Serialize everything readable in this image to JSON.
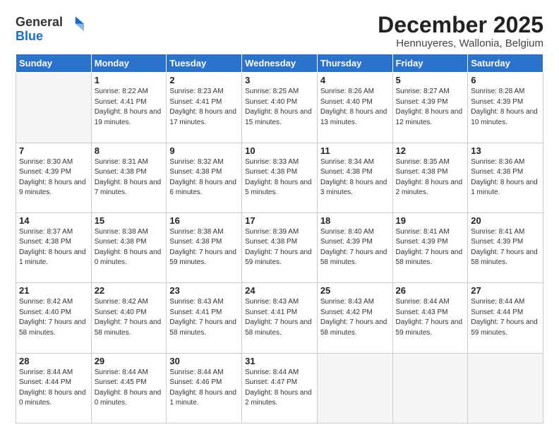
{
  "header": {
    "logo_line1": "General",
    "logo_line2": "Blue",
    "month": "December 2025",
    "location": "Hennuyeres, Wallonia, Belgium"
  },
  "weekdays": [
    "Sunday",
    "Monday",
    "Tuesday",
    "Wednesday",
    "Thursday",
    "Friday",
    "Saturday"
  ],
  "weeks": [
    [
      {
        "day": "",
        "sunrise": "",
        "sunset": "",
        "daylight": ""
      },
      {
        "day": "1",
        "sunrise": "8:22 AM",
        "sunset": "4:41 PM",
        "daylight": "8 hours and 19 minutes."
      },
      {
        "day": "2",
        "sunrise": "8:23 AM",
        "sunset": "4:41 PM",
        "daylight": "8 hours and 17 minutes."
      },
      {
        "day": "3",
        "sunrise": "8:25 AM",
        "sunset": "4:40 PM",
        "daylight": "8 hours and 15 minutes."
      },
      {
        "day": "4",
        "sunrise": "8:26 AM",
        "sunset": "4:40 PM",
        "daylight": "8 hours and 13 minutes."
      },
      {
        "day": "5",
        "sunrise": "8:27 AM",
        "sunset": "4:39 PM",
        "daylight": "8 hours and 12 minutes."
      },
      {
        "day": "6",
        "sunrise": "8:28 AM",
        "sunset": "4:39 PM",
        "daylight": "8 hours and 10 minutes."
      }
    ],
    [
      {
        "day": "7",
        "sunrise": "8:30 AM",
        "sunset": "4:39 PM",
        "daylight": "8 hours and 9 minutes."
      },
      {
        "day": "8",
        "sunrise": "8:31 AM",
        "sunset": "4:38 PM",
        "daylight": "8 hours and 7 minutes."
      },
      {
        "day": "9",
        "sunrise": "8:32 AM",
        "sunset": "4:38 PM",
        "daylight": "8 hours and 6 minutes."
      },
      {
        "day": "10",
        "sunrise": "8:33 AM",
        "sunset": "4:38 PM",
        "daylight": "8 hours and 5 minutes."
      },
      {
        "day": "11",
        "sunrise": "8:34 AM",
        "sunset": "4:38 PM",
        "daylight": "8 hours and 3 minutes."
      },
      {
        "day": "12",
        "sunrise": "8:35 AM",
        "sunset": "4:38 PM",
        "daylight": "8 hours and 2 minutes."
      },
      {
        "day": "13",
        "sunrise": "8:36 AM",
        "sunset": "4:38 PM",
        "daylight": "8 hours and 1 minute."
      }
    ],
    [
      {
        "day": "14",
        "sunrise": "8:37 AM",
        "sunset": "4:38 PM",
        "daylight": "8 hours and 1 minute."
      },
      {
        "day": "15",
        "sunrise": "8:38 AM",
        "sunset": "4:38 PM",
        "daylight": "8 hours and 0 minutes."
      },
      {
        "day": "16",
        "sunrise": "8:38 AM",
        "sunset": "4:38 PM",
        "daylight": "7 hours and 59 minutes."
      },
      {
        "day": "17",
        "sunrise": "8:39 AM",
        "sunset": "4:38 PM",
        "daylight": "7 hours and 59 minutes."
      },
      {
        "day": "18",
        "sunrise": "8:40 AM",
        "sunset": "4:39 PM",
        "daylight": "7 hours and 58 minutes."
      },
      {
        "day": "19",
        "sunrise": "8:41 AM",
        "sunset": "4:39 PM",
        "daylight": "7 hours and 58 minutes."
      },
      {
        "day": "20",
        "sunrise": "8:41 AM",
        "sunset": "4:39 PM",
        "daylight": "7 hours and 58 minutes."
      }
    ],
    [
      {
        "day": "21",
        "sunrise": "8:42 AM",
        "sunset": "4:40 PM",
        "daylight": "7 hours and 58 minutes."
      },
      {
        "day": "22",
        "sunrise": "8:42 AM",
        "sunset": "4:40 PM",
        "daylight": "7 hours and 58 minutes."
      },
      {
        "day": "23",
        "sunrise": "8:43 AM",
        "sunset": "4:41 PM",
        "daylight": "7 hours and 58 minutes."
      },
      {
        "day": "24",
        "sunrise": "8:43 AM",
        "sunset": "4:41 PM",
        "daylight": "7 hours and 58 minutes."
      },
      {
        "day": "25",
        "sunrise": "8:43 AM",
        "sunset": "4:42 PM",
        "daylight": "7 hours and 58 minutes."
      },
      {
        "day": "26",
        "sunrise": "8:44 AM",
        "sunset": "4:43 PM",
        "daylight": "7 hours and 59 minutes."
      },
      {
        "day": "27",
        "sunrise": "8:44 AM",
        "sunset": "4:44 PM",
        "daylight": "7 hours and 59 minutes."
      }
    ],
    [
      {
        "day": "28",
        "sunrise": "8:44 AM",
        "sunset": "4:44 PM",
        "daylight": "8 hours and 0 minutes."
      },
      {
        "day": "29",
        "sunrise": "8:44 AM",
        "sunset": "4:45 PM",
        "daylight": "8 hours and 0 minutes."
      },
      {
        "day": "30",
        "sunrise": "8:44 AM",
        "sunset": "4:46 PM",
        "daylight": "8 hours and 1 minute."
      },
      {
        "day": "31",
        "sunrise": "8:44 AM",
        "sunset": "4:47 PM",
        "daylight": "8 hours and 2 minutes."
      },
      {
        "day": "",
        "sunrise": "",
        "sunset": "",
        "daylight": ""
      },
      {
        "day": "",
        "sunrise": "",
        "sunset": "",
        "daylight": ""
      },
      {
        "day": "",
        "sunrise": "",
        "sunset": "",
        "daylight": ""
      }
    ]
  ]
}
